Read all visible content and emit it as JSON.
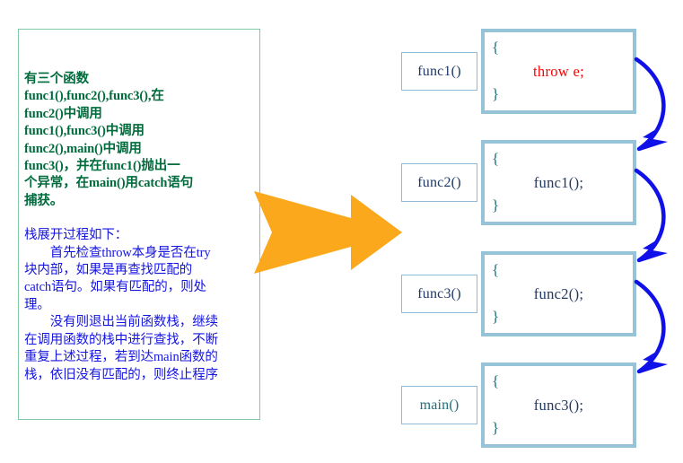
{
  "description_panel": {
    "paragraphs": [
      {
        "color": "#006b3c",
        "text": "有三个函数\nfunc1(),func2(),func3(),在\nfunc2()中调用\nfunc1(),func3()中调用\nfunc2(),main()中调用\nfunc3()，并在func1()抛出一\n个异常，在main()用catch语句\n捕获。"
      },
      {
        "color": "#1414e0",
        "text": "栈展开过程如下：\n　　首先检查throw本身是否在try\n块内部，如果是再查找匹配的\ncatch语句。如果有匹配的，则处\n理。\n　　没有则退出当前函数栈，继续\n在调用函数的栈中进行查找，不断\n重复上述过程，若到达main函数的\n栈，依旧没有匹配的，则终止程序"
      }
    ]
  },
  "flow_arrow": {
    "icon": "right-arrow-icon",
    "color": "#FBA81C"
  },
  "call_stack": {
    "frames": [
      {
        "label": "func1()",
        "label_color": "#1f3864",
        "open_brace": "{",
        "statement": "throw e;",
        "statement_color": "#ff0000",
        "close_brace": "}"
      },
      {
        "label": "func2()",
        "label_color": "#1f3864",
        "open_brace": "{",
        "statement": "func1();",
        "statement_color": "#1f3864",
        "close_brace": "}"
      },
      {
        "label": "func3()",
        "label_color": "#1f3864",
        "open_brace": "{",
        "statement": "func2();",
        "statement_color": "#1f3864",
        "close_brace": "}"
      },
      {
        "label": "main()",
        "label_color": "#1f6f7a",
        "open_brace": "{",
        "statement": "func3();",
        "statement_color": "#1f3864",
        "close_brace": "}"
      }
    ],
    "unwind_arrow_color": "#1010e8",
    "frame_border_color": "#96c3d8",
    "label_border_color": "#8fbdd8"
  }
}
